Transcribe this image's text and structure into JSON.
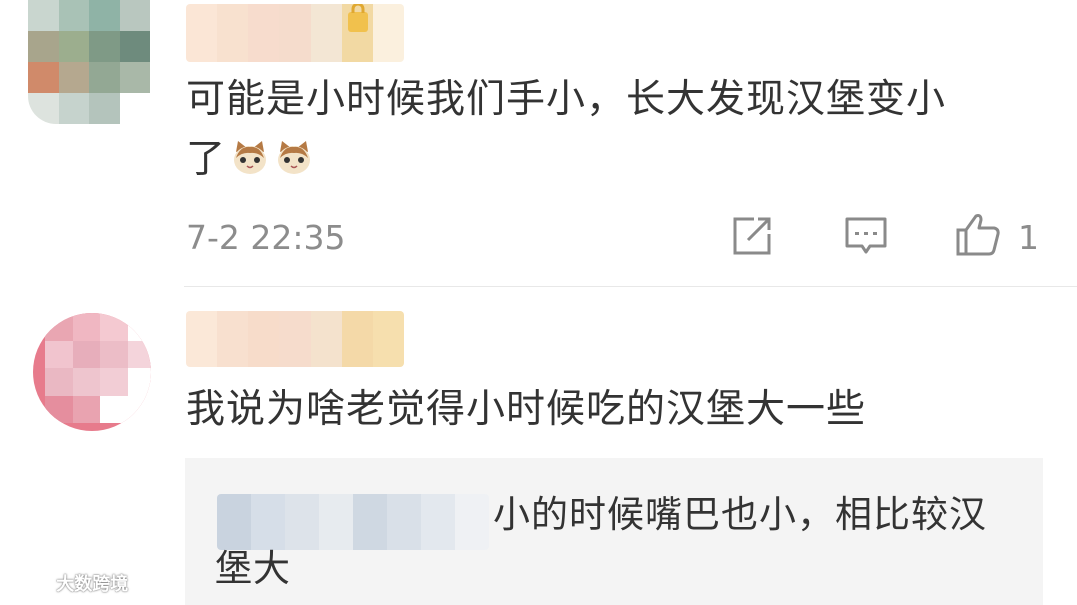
{
  "comments": [
    {
      "text_line1": "可能是小时候我们手小，长大发现汉堡变小",
      "text_line2": "了",
      "emoji": "cat-face-icon",
      "time": "7-2 22:35",
      "like_count": "1"
    },
    {
      "text": "我说为啥老觉得小时候吃的汉堡大一些",
      "reply": {
        "text_line1": "小的时候嘴巴也小，相比较汉",
        "text_line2": "堡大"
      }
    }
  ],
  "watermark": "大数跨境",
  "colors": {
    "text": "#333333",
    "meta": "#8c8c8c",
    "reply_bg": "#f4f4f4",
    "divider": "#e8e8e8"
  }
}
